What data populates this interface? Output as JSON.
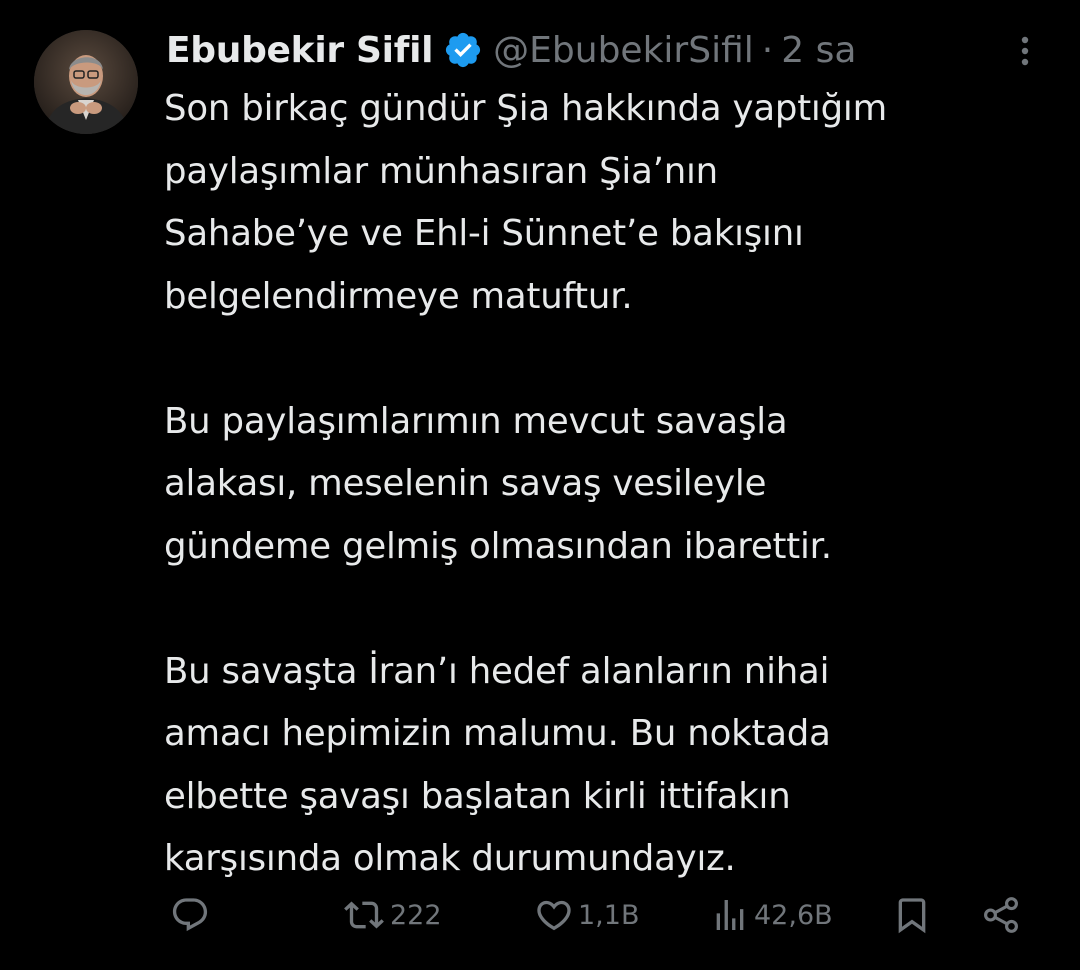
{
  "tweet": {
    "author": {
      "display_name": "Ebubekir Sifil",
      "handle": "@EbubekirSifil",
      "separator": "·",
      "time": "2 sa",
      "verified": true,
      "avatar_icon": "user-photo"
    },
    "paragraphs": [
      {
        "lines": [
          "Son birkaç gündür Şia hakkında yaptığım",
          "paylaşımlar münhasıran Şia’nın",
          "Sahabe’ye ve Ehl-i Sünnet’e bakışını",
          "belgelendirmeye matuftur."
        ]
      },
      {
        "lines": [
          "Bu paylaşımlarımın mevcut savaşla",
          "alakası, meselenin savaş vesileyle",
          "gündeme gelmiş olmasından ibarettir."
        ]
      },
      {
        "lines": [
          "Bu savaşta İran’ı hedef alanların nihai",
          "amacı hepimizin malumu. Bu noktada",
          "elbette şavaşı başlatan kirli ittifakın",
          "karşısında olmak durumundayız."
        ]
      }
    ],
    "actions": {
      "reply_icon": "reply-icon",
      "retweet_count": "222",
      "like_count": "1,1B",
      "views_count": "42,6B",
      "bookmark_icon": "bookmark-icon",
      "share_icon": "share-icon"
    }
  },
  "colors": {
    "background": "#000000",
    "text_primary": "#e7e9ea",
    "text_secondary": "#71767b",
    "verified_blue": "#1d9bf0"
  }
}
